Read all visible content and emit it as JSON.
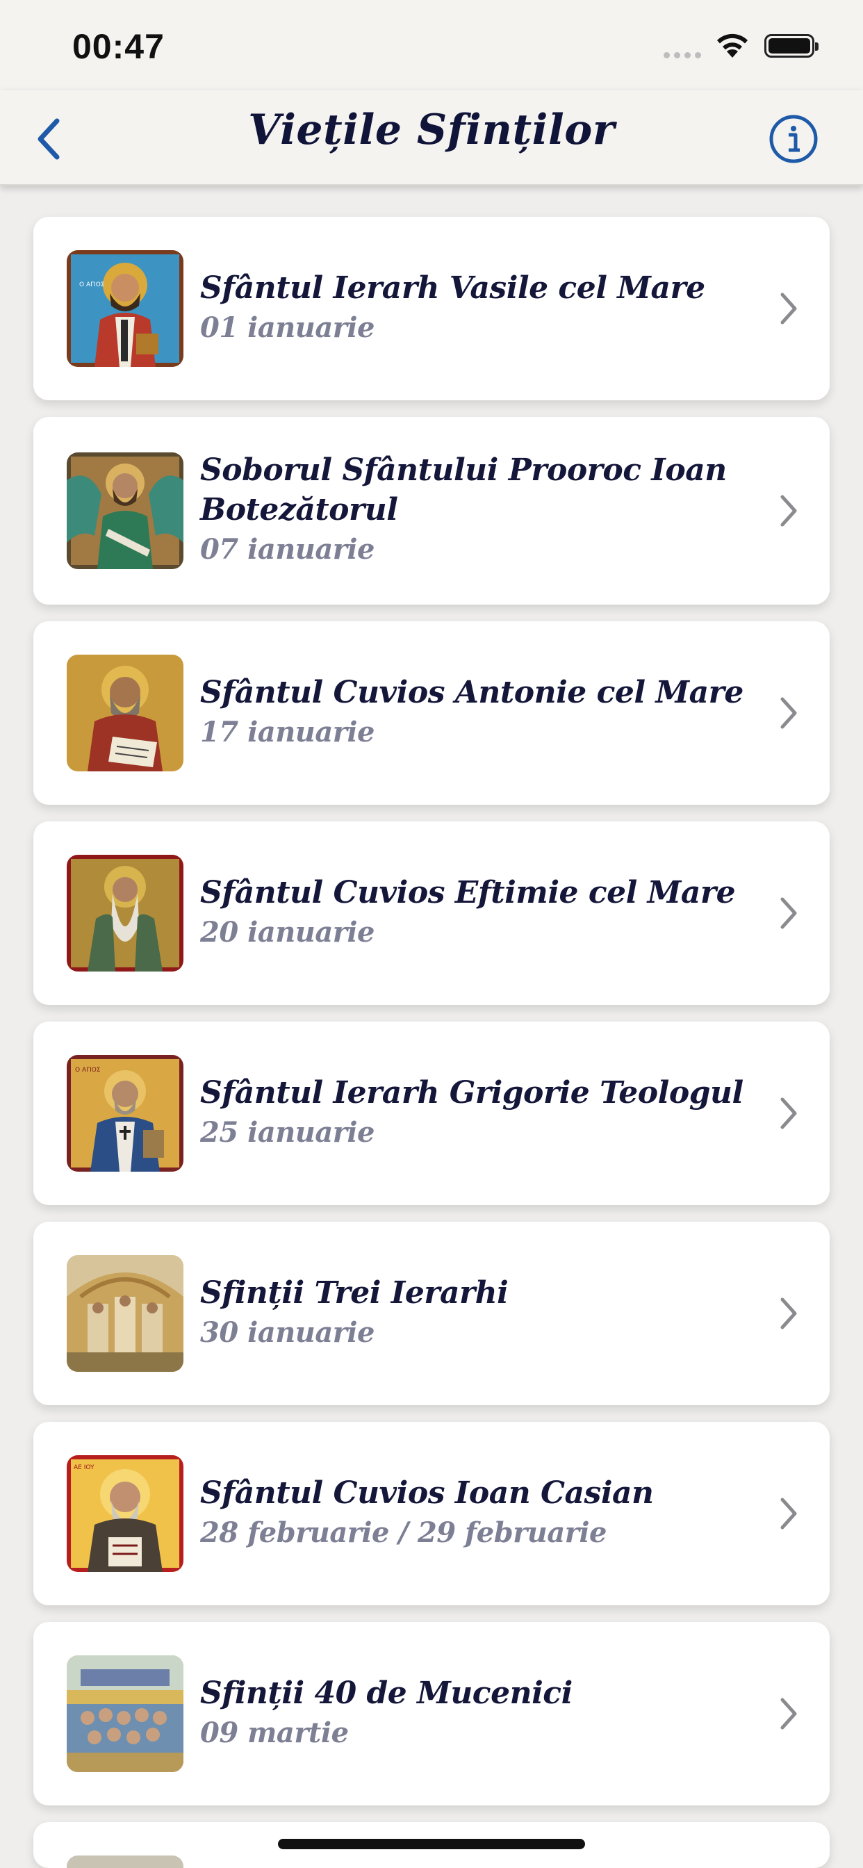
{
  "status_bar": {
    "time": "00:47"
  },
  "nav": {
    "title": "Viețile Sfinților"
  },
  "saints": [
    {
      "name": "Sfântul Ierarh Vasile cel Mare",
      "date": "01 ianuarie"
    },
    {
      "name": "Soborul Sfântului Prooroc Ioan Botezătorul",
      "date": "07 ianuarie"
    },
    {
      "name": "Sfântul Cuvios Antonie cel Mare",
      "date": "17 ianuarie"
    },
    {
      "name": "Sfântul Cuvios Eftimie cel Mare",
      "date": "20 ianuarie"
    },
    {
      "name": "Sfântul Ierarh Grigorie Teologul",
      "date": "25 ianuarie"
    },
    {
      "name": "Sfinții Trei Ierarhi",
      "date": "30 ianuarie"
    },
    {
      "name": "Sfântul Cuvios Ioan Casian",
      "date": "28 februarie / 29 februarie"
    },
    {
      "name": "Sfinții 40 de Mucenici",
      "date": "09 martie"
    }
  ],
  "colors": {
    "accent": "#1f5aa8",
    "title_text": "#15173a",
    "date_text": "#7d7f94",
    "background": "#efeeec"
  },
  "icons": {
    "back": "chevron-left-icon",
    "info": "info-circle-icon",
    "row_disclosure": "chevron-right-icon"
  }
}
